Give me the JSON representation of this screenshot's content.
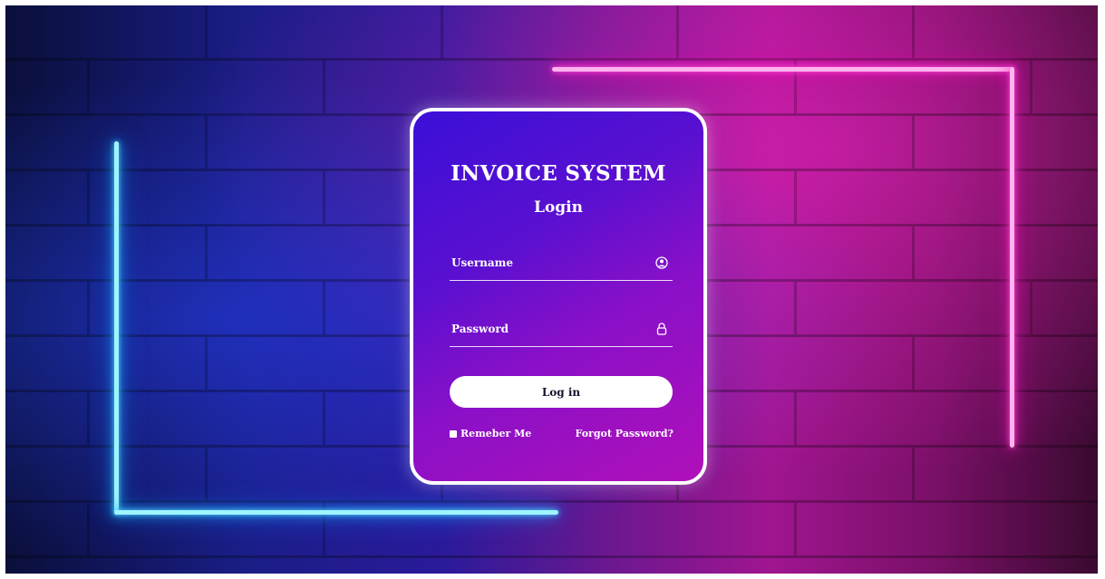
{
  "login_card": {
    "title": "INVOICE SYSTEM",
    "subtitle": "Login",
    "username": {
      "value": "",
      "placeholder": "Username",
      "icon": "user-circle-icon"
    },
    "password": {
      "value": "",
      "placeholder": "Password",
      "icon": "lock-icon"
    },
    "login_button_label": "Log in",
    "remember_me_label": "Remeber Me",
    "forgot_password_label": "Forgot Password?"
  },
  "colors": {
    "neon_blue": "#4fd9ff",
    "neon_pink": "#ff4fd8",
    "card_gradient_start": "#3b0fd8",
    "card_gradient_end": "#b010b8",
    "button_bg": "#ffffff"
  }
}
